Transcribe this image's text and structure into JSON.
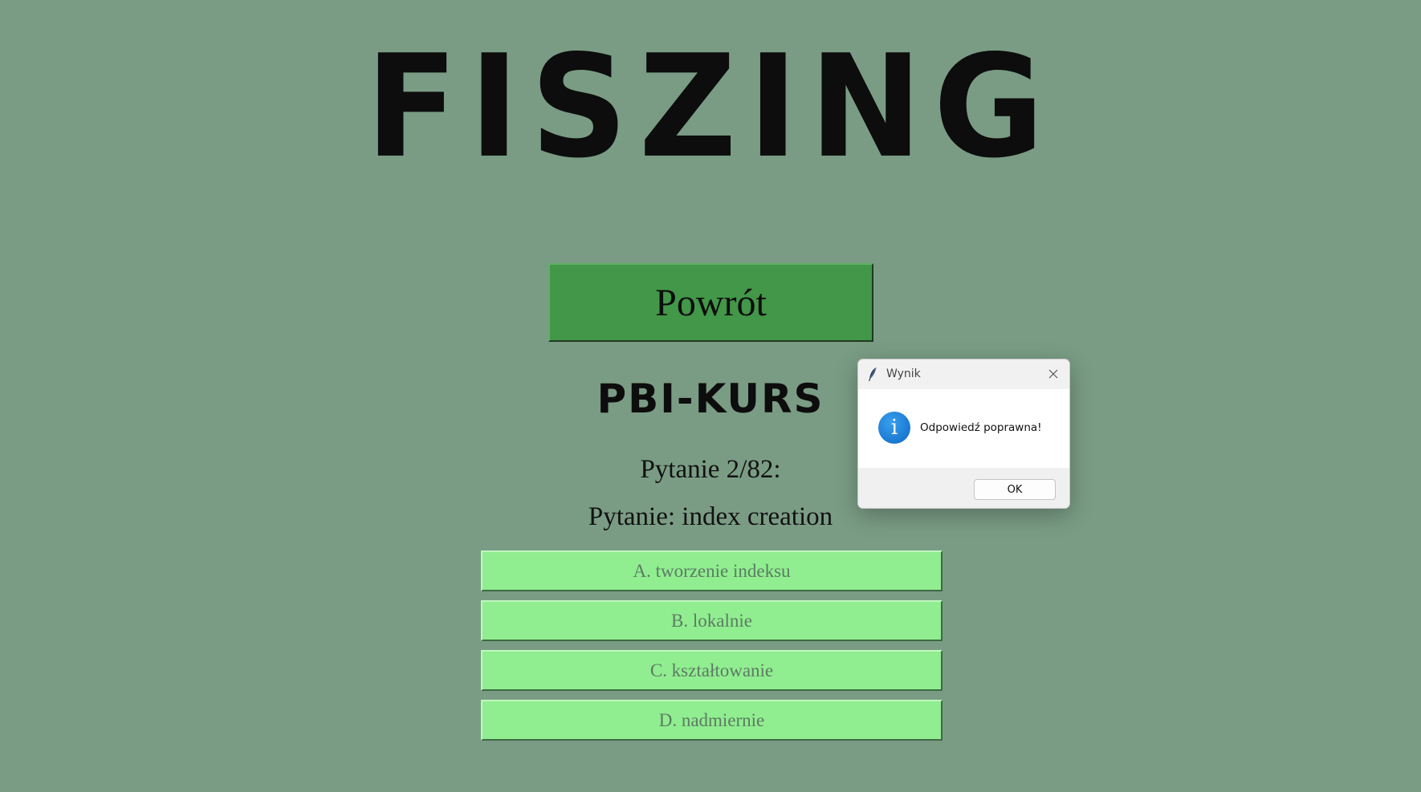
{
  "app": {
    "title": "FISZING"
  },
  "navigation": {
    "back_label": "Powrót"
  },
  "quiz": {
    "course": "PBI-KURS",
    "counter": "Pytanie 2/82:",
    "question": "Pytanie: index creation",
    "answers": [
      {
        "label": "A. tworzenie indeksu"
      },
      {
        "label": "B. lokalnie"
      },
      {
        "label": "C. kształtowanie"
      },
      {
        "label": "D. nadmiernie"
      }
    ]
  },
  "dialog": {
    "title": "Wynik",
    "message": "Odpowiedź poprawna!",
    "ok_label": "OK",
    "icon": "info-icon",
    "info_glyph": "i"
  },
  "colors": {
    "background": "#7a9c84",
    "back_button": "#429748",
    "answer_button": "#90ee90",
    "info_icon": "#1a78d2"
  }
}
